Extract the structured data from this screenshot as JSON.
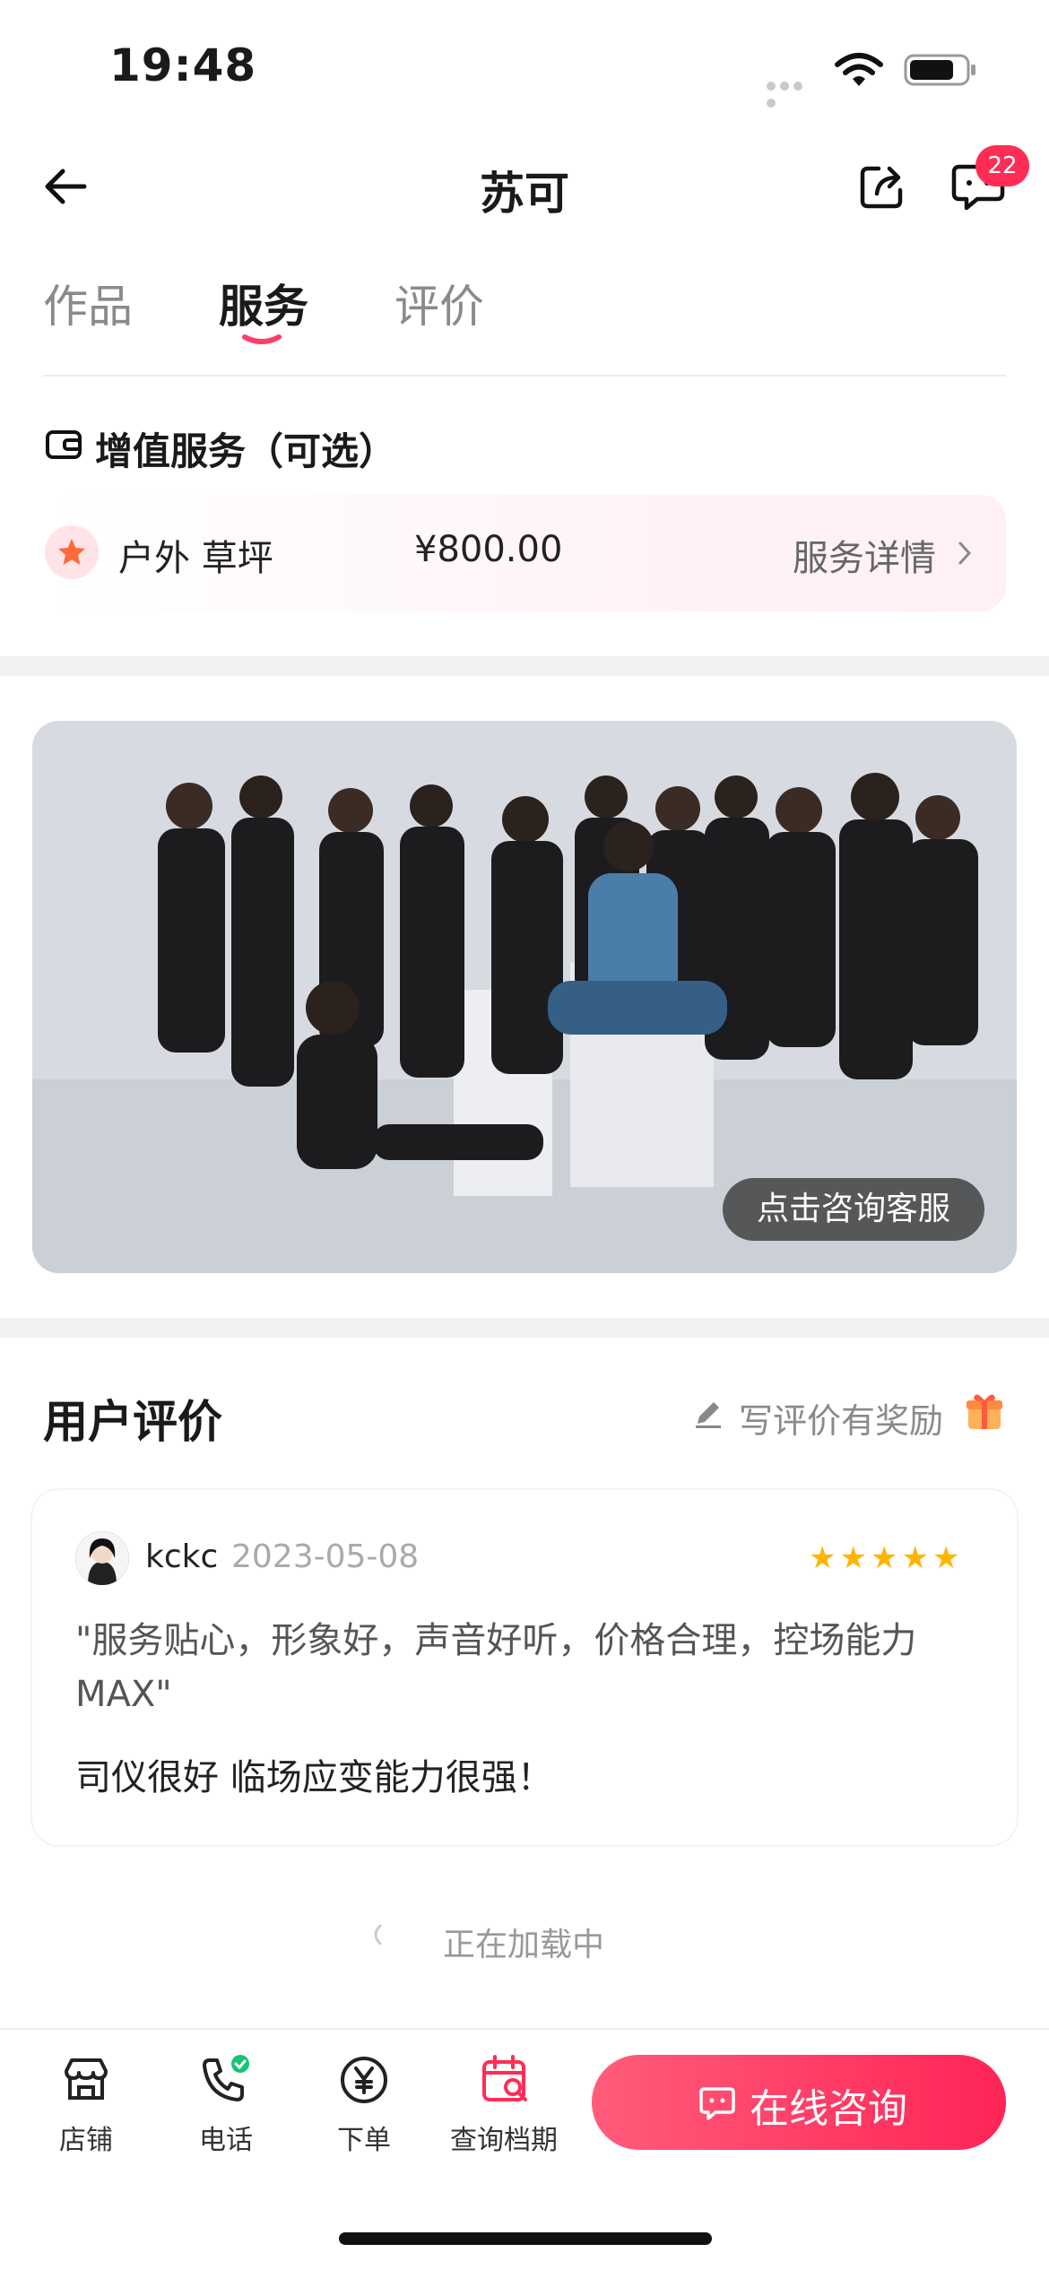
{
  "status_bar": {
    "time": "19:48"
  },
  "nav": {
    "title": "苏可",
    "message_badge": "22"
  },
  "tabs": [
    {
      "label": "作品",
      "active": false
    },
    {
      "label": "服务",
      "active": true
    },
    {
      "label": "评价",
      "active": false
    }
  ],
  "value_services": {
    "title": "增值服务（可选）",
    "item": {
      "name": "户外 草坪",
      "price": "¥800.00",
      "detail_link": "服务详情"
    }
  },
  "photo": {
    "consult_label": "点击咨询客服"
  },
  "reviews": {
    "title": "用户评价",
    "write_link": "写评价有奖励",
    "items": [
      {
        "user": "kckc",
        "date": "2023-05-08",
        "rating": 5,
        "tags": "\"服务贴心，形象好，声音好听，价格合理，控场能力MAX\"",
        "text": "司仪很好 临场应变能力很强！"
      }
    ],
    "loading": "正在加载中"
  },
  "bottom_bar": {
    "items": [
      {
        "label": "店铺",
        "icon": "store-icon"
      },
      {
        "label": "电话",
        "icon": "phone-icon"
      },
      {
        "label": "下单",
        "icon": "yen-icon"
      },
      {
        "label": "查询档期",
        "icon": "calendar-search-icon"
      }
    ],
    "consult_button": "在线咨询"
  },
  "colors": {
    "accent": "#ff2d55",
    "star": "#ffb400"
  }
}
